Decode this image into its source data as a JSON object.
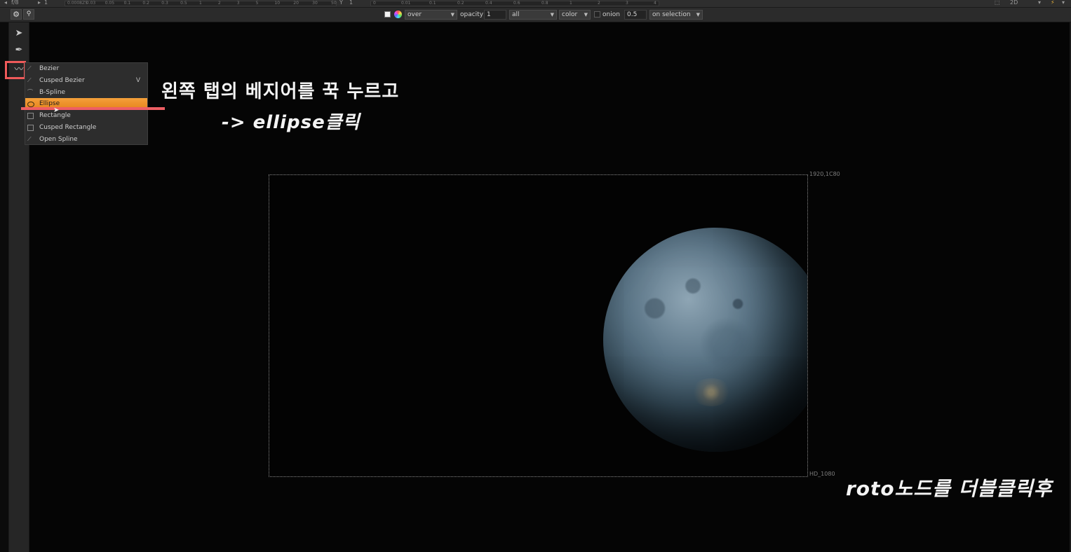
{
  "ruler": {
    "frame_label": "f/8",
    "gain_value": "1",
    "gain_ticks": [
      "0.0008Z5",
      "0.03",
      "0.05",
      "0.1",
      "0.2",
      "0.3",
      "0.5",
      "1",
      "2",
      "3",
      "5",
      "10",
      "20",
      "30",
      "50"
    ],
    "gamma_label": "Y",
    "gamma_value": "1",
    "gamma_ticks": [
      "0",
      "0.01",
      "0.1",
      "0.2",
      "0.4",
      "0.6",
      "0.8",
      "1",
      "2",
      "3",
      "4"
    ],
    "view_mode": "2D"
  },
  "toolbar": {
    "settings_icon": "gear-icon",
    "link_icon": "link-icon",
    "blend_mode": "over",
    "opacity_label": "opacity",
    "opacity_value": "1",
    "channels": "all",
    "color_mode": "color",
    "onion_label": "onion",
    "onion_value": "0.5",
    "display_mode": "on selection"
  },
  "left_tools": {
    "select_icon": "arrow-icon",
    "points_icon": "pen-plus-icon",
    "shape_icon": "bezier-curve-icon"
  },
  "shape_menu": {
    "items": [
      {
        "label": "Bezier",
        "icon": "bezier-icon",
        "shortcut": ""
      },
      {
        "label": "Cusped Bezier",
        "icon": "cusped-bezier-icon",
        "shortcut": "V"
      },
      {
        "label": "B-Spline",
        "icon": "b-spline-icon",
        "shortcut": ""
      },
      {
        "label": "Ellipse",
        "icon": "ellipse-icon",
        "shortcut": ""
      },
      {
        "label": "Rectangle",
        "icon": "rectangle-icon",
        "shortcut": ""
      },
      {
        "label": "Cusped Rectangle",
        "icon": "cusped-rectangle-icon",
        "shortcut": ""
      },
      {
        "label": "Open Spline",
        "icon": "open-spline-icon",
        "shortcut": ""
      }
    ],
    "selected": "Ellipse"
  },
  "annotations": {
    "line1": "왼쪽 탭의 베지어를 꾹 누르고",
    "line2": "-> ellipse클릭",
    "bottom": "roto노드를 더블클릭후"
  },
  "frame": {
    "top_right_label": "1920,1C80",
    "bottom_right_label": "HD_1080"
  },
  "colors": {
    "highlight": "#ef5a5a",
    "menu_active": "#f0962e",
    "background": "#050505"
  }
}
